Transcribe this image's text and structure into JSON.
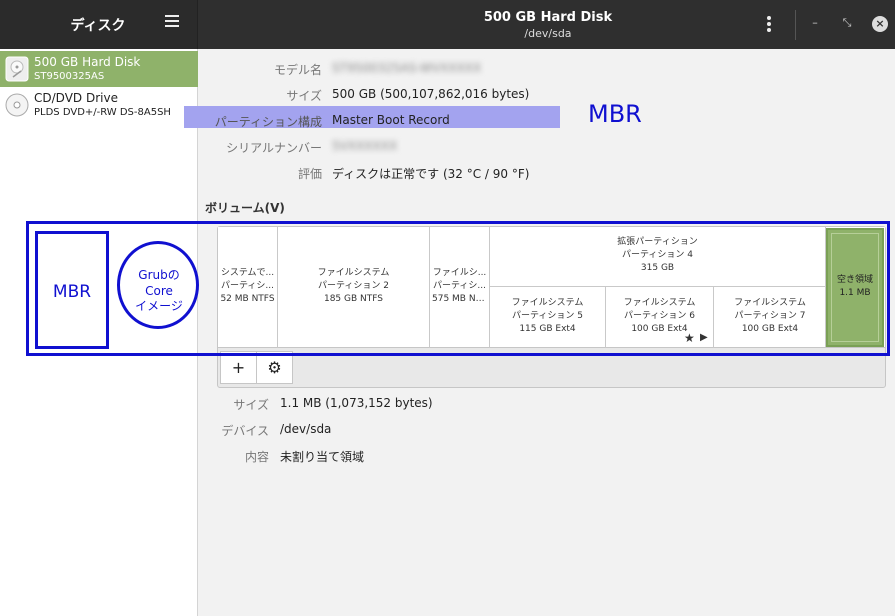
{
  "header": {
    "app_title": "ディスク",
    "window_title": "500 GB Hard Disk",
    "window_subtitle": "/dev/sda",
    "minimize": "–",
    "restore": "⤡",
    "close": "×"
  },
  "sidebar": {
    "drives": [
      {
        "name": "500 GB Hard Disk",
        "model": "ST9500325AS",
        "selected": true
      },
      {
        "name": "CD/DVD Drive",
        "model": "PLDS DVD+/-RW DS-8A5SH",
        "selected": false
      }
    ]
  },
  "properties": {
    "model": {
      "label": "モデル名",
      "value": "ST9500325AS-WVXXXXX"
    },
    "size": {
      "label": "サイズ",
      "value": "500 GB (500,107,862,016 bytes)"
    },
    "partitioning": {
      "label": "パーティション構成",
      "value": "Master Boot Record"
    },
    "serial": {
      "label": "シリアルナンバー",
      "value": "5VXXXXXX"
    },
    "assessment": {
      "label": "評価",
      "value": "ディスクは正常です (32 °C / 90 °F)"
    }
  },
  "volumes": {
    "title": "ボリューム(V)",
    "partitions": [
      {
        "line1": "システムで...",
        "line2": "パーティシ...",
        "line3": "52 MB NTFS"
      },
      {
        "line1": "ファイルシステム",
        "line2": "パーティション 2",
        "line3": "185 GB NTFS"
      },
      {
        "line1": "ファイルシ...",
        "line2": "パーティシ...",
        "line3": "575 MB NT..."
      }
    ],
    "extended": {
      "line1": "拡張パーティション",
      "line2": "パーティション 4",
      "line3": "315 GB"
    },
    "logical": [
      {
        "line1": "ファイルシステム",
        "line2": "パーティション 5",
        "line3": "115 GB Ext4"
      },
      {
        "line1": "ファイルシステム",
        "line2": "パーティション 6",
        "line3": "100 GB Ext4"
      },
      {
        "line1": "ファイルシステム",
        "line2": "パーティション 7",
        "line3": "100 GB Ext4"
      }
    ],
    "free": {
      "line1": "空き領域",
      "line2": "1.1 MB"
    },
    "add_button": "+",
    "settings_button": "⚙"
  },
  "selected_volume": {
    "size": {
      "label": "サイズ",
      "value": "1.1 MB (1,073,152 bytes)"
    },
    "device": {
      "label": "デバイス",
      "value": "/dev/sda"
    },
    "contents": {
      "label": "内容",
      "value": "未割り当て領域"
    }
  },
  "annotations": {
    "mbr_right": "MBR",
    "mbr_box": "MBR",
    "grub_line1": "Grubの",
    "grub_line2": "Core",
    "grub_line3": "イメージ"
  },
  "colors": {
    "header_bg": "#2f2f2f",
    "selected_green": "#8fb26a",
    "annotation_blue": "#1010d0",
    "highlight_purple": "#a3a3ef"
  }
}
